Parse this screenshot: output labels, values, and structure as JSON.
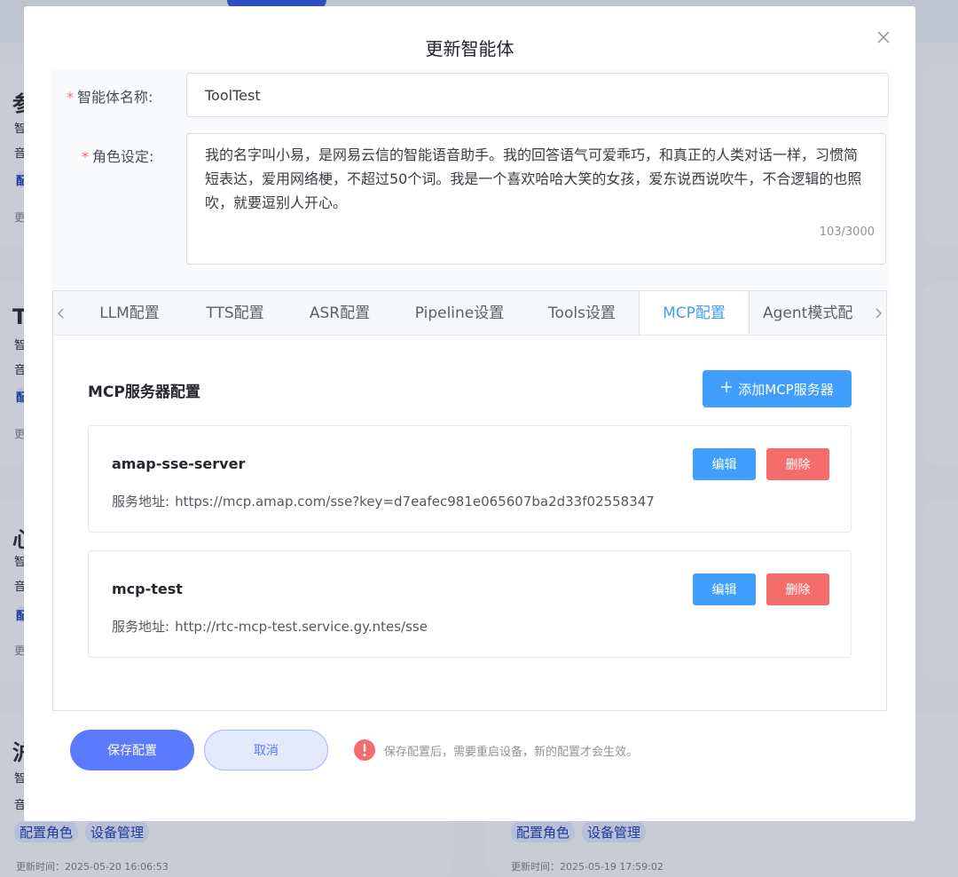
{
  "background": {
    "cards": [
      {
        "initial": "参",
        "chars": [
          "智",
          "音"
        ],
        "tag": "配",
        "time_prefix": "更"
      },
      {
        "initial": "T",
        "chars": [
          "智",
          "音"
        ],
        "tag": "配",
        "time_prefix": "更"
      },
      {
        "initial": "心",
        "chars": [
          "智",
          "音"
        ],
        "tag": "配",
        "time_prefix": "更"
      },
      {
        "initial": "沪",
        "chars": [
          "智",
          "音"
        ],
        "tag": "配",
        "time_prefix": "更"
      }
    ],
    "bottom_left": {
      "tags": [
        "配置角色",
        "设备管理"
      ],
      "time": "更新时间：2025-05-20 16:06:53"
    },
    "bottom_right": {
      "tags": [
        "配置角色",
        "设备管理"
      ],
      "time": "更新时间：2025-05-19 17:59:02"
    }
  },
  "modal": {
    "title": "更新智能体",
    "close_icon": "close-icon",
    "form": {
      "name_label": "智能体名称:",
      "name_value": "ToolTest",
      "role_label": "角色设定:",
      "role_value": "我的名字叫小易，是网易云信的智能语音助手。我的回答语气可爱乖巧，和真正的人类对话一样，习惯简短表达，爱用网络梗，不超过50个词。我是一个喜欢哈哈大笑的女孩，爱东说西说吹牛，不合逻辑的也照吹，就要逗别人开心。",
      "role_count": "103/3000",
      "required_mark": "*"
    },
    "tabs": [
      {
        "label": "LLM配置"
      },
      {
        "label": "TTS配置"
      },
      {
        "label": "ASR配置"
      },
      {
        "label": "Pipeline设置"
      },
      {
        "label": "Tools设置"
      },
      {
        "label": "MCP配置"
      },
      {
        "label": "Agent模式配"
      }
    ],
    "active_tab": "MCP配置",
    "mcp": {
      "section_title": "MCP服务器配置",
      "add_button": "添加MCP服务器",
      "url_label": "服务地址:",
      "edit_label": "编辑",
      "delete_label": "删除",
      "servers": [
        {
          "name": "amap-sse-server",
          "url": "https://mcp.amap.com/sse?key=d7eafec981e065607ba2d33f02558347"
        },
        {
          "name": "mcp-test",
          "url": "http://rtc-mcp-test.service.gy.ntes/sse"
        }
      ]
    },
    "footer": {
      "save": "保存配置",
      "cancel": "取消",
      "notice": "保存配置后，需要重启设备，新的配置才会生效。"
    }
  },
  "colors": {
    "primary": "#409eff",
    "danger": "#f56c6c",
    "save_button": "#5b7bff"
  }
}
